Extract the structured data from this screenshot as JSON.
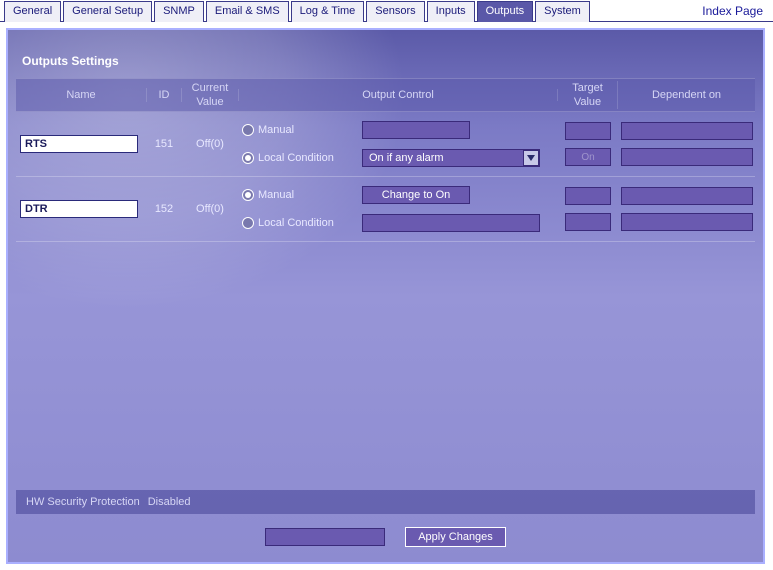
{
  "tabs": {
    "items": [
      {
        "label": "General"
      },
      {
        "label": "General Setup"
      },
      {
        "label": "SNMP"
      },
      {
        "label": "Email & SMS"
      },
      {
        "label": "Log & Time"
      },
      {
        "label": "Sensors"
      },
      {
        "label": "Inputs"
      },
      {
        "label": "Outputs"
      },
      {
        "label": "System"
      }
    ],
    "active_index": 7,
    "index_link": "Index Page"
  },
  "section_title": "Outputs Settings",
  "columns": {
    "name": "Name",
    "id": "ID",
    "current": "Current Value",
    "control": "Output Control",
    "target": "Target Value",
    "dependent": "Dependent on"
  },
  "control_labels": {
    "manual": "Manual",
    "local": "Local Condition"
  },
  "outputs": [
    {
      "name": "RTS",
      "id": "151",
      "current": "Off(0)",
      "mode_selected": "local",
      "manual_button": "",
      "local_dropdown": "On if any alarm",
      "target_manual": "",
      "target_local": "On"
    },
    {
      "name": "DTR",
      "id": "152",
      "current": "Off(0)",
      "mode_selected": "manual",
      "manual_button": "Change to On",
      "local_dropdown": "",
      "target_manual": "",
      "target_local": ""
    }
  ],
  "footer": {
    "hw_label": "HW Security Protection",
    "hw_value": "Disabled",
    "apply": "Apply Changes"
  }
}
